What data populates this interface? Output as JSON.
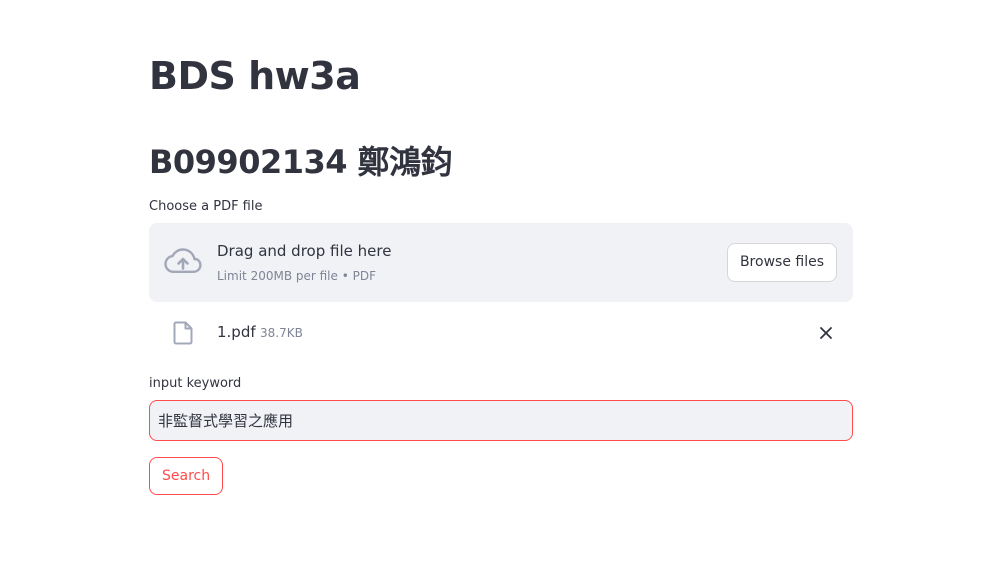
{
  "page": {
    "title": "BDS hw3a",
    "subtitle": "B09902134 鄭鴻鈞"
  },
  "uploader": {
    "label": "Choose a PDF file",
    "drop_text": "Drag and drop file here",
    "limit_text": "Limit 200MB per file • PDF",
    "browse_label": "Browse files",
    "icon": "cloud-upload-icon"
  },
  "uploaded_file": {
    "name": "1.pdf",
    "size": "38.7KB",
    "icon": "file-icon",
    "remove_icon": "close-icon"
  },
  "keyword": {
    "label": "input keyword",
    "value": "非監督式學習之應用"
  },
  "search_button": {
    "label": "Search"
  },
  "colors": {
    "accent": "#ff4b4b",
    "text": "#31333f",
    "muted": "#808495",
    "surface": "#f0f2f6"
  }
}
